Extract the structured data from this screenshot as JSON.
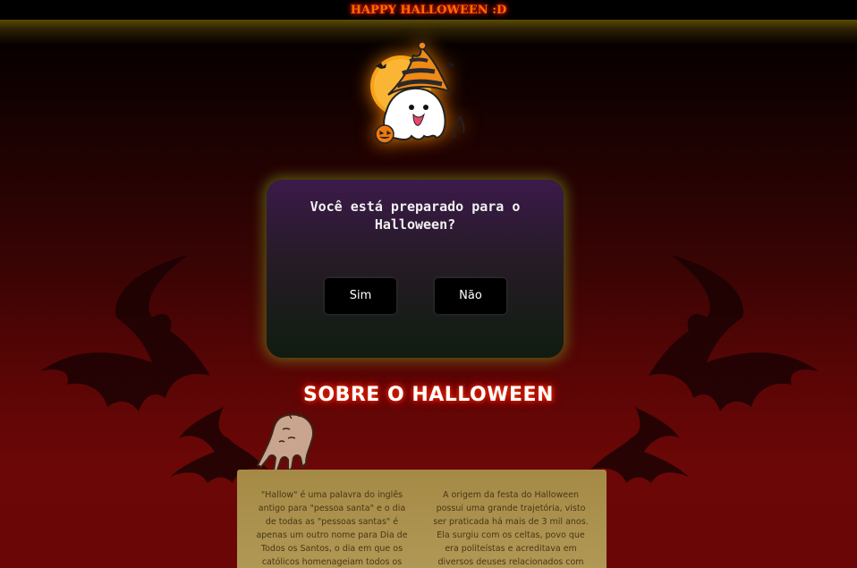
{
  "header": {
    "title": "HAPPY HALLOWEEN :D"
  },
  "quiz": {
    "question": "Você está preparado para o Halloween?",
    "yes_label": "Sim",
    "no_label": "Não"
  },
  "about": {
    "title": "SOBRE O HALLOWEEN",
    "paragraph_1": "\"Hallow\" é uma palavra do inglês antigo para \"pessoa santa\" e o dia de todas as \"pessoas santas\" é apenas um outro nome para Dia de Todos os Santos, o dia em que os católicos homenageiam todos os",
    "paragraph_2": "A origem da festa do Halloween possui uma grande trajetória, visto ser praticada há mais de 3 mil anos. Ela surgiu com os celtas, povo que era politeístas e acreditava em diversos deuses relacionados com"
  },
  "icons": {
    "mascot": "ghost-witch-hat-icon",
    "hand": "crawling-hand-icon",
    "bats": "bat-silhouette-icon"
  },
  "colors": {
    "header_text": "#ff6a00",
    "panel_glow": "#78961e",
    "card_background": "#a48a45"
  }
}
